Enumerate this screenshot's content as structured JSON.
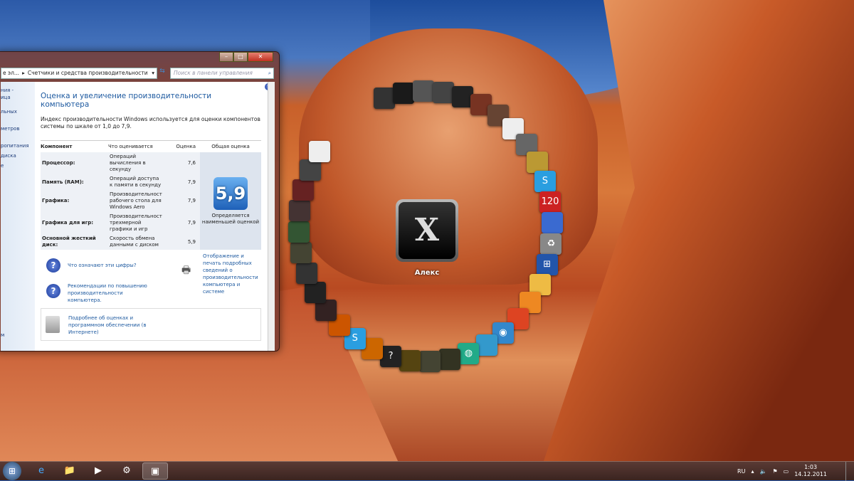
{
  "window": {
    "breadcrumb_prev": "е эл...",
    "breadcrumb_current": "Счетчики и средства производительности",
    "search_placeholder": "Поиск в панели управления",
    "sidebar_fragments": [
      "ния -",
      "ица",
      "льных",
      "метров",
      "ропитания",
      "диска",
      "е",
      "м"
    ],
    "title": "Оценка и увеличение производительности компьютера",
    "description": "Индекс производительности Windows используется для оценки компонентов системы по шкале от 1,0 до 7,9.",
    "table": {
      "headers": [
        "Компонент",
        "Что оценивается",
        "Оценка",
        "Общая оценка"
      ],
      "rows": [
        {
          "component": "Процессор:",
          "what": "Операций вычисления в секунду",
          "score": "7,6"
        },
        {
          "component": "Память (RAM):",
          "what": "Операций доступа к памяти в секунду",
          "score": "7,9"
        },
        {
          "component": "Графика:",
          "what": "Производительност рабочего стола для Windows Aero",
          "score": "7,9"
        },
        {
          "component": "Графика для игр:",
          "what": "Производительност трехмерной графики и игр",
          "score": "7,9"
        },
        {
          "component": "Основной жесткий диск:",
          "what": "Скорость обмена данными с диском",
          "score": "5,9"
        }
      ],
      "base_score": "5,9",
      "base_note": "Определяется наименьшей оценкой"
    },
    "links": {
      "what_numbers": "Что означают эти цифры?",
      "tips": "Рекомендации по повышению производительности компьютера.",
      "print": "Отображение и печать подробных сведений о производительности компьютера и системе",
      "more": "Подробнее об оценках и программном обеспечении (в Интернете)"
    }
  },
  "desktop": {
    "user_name": "Алекс",
    "user_tile_letter": "X",
    "icons": [
      "game",
      "game",
      "game",
      "game",
      "world-of-tanks",
      "game",
      "game",
      "solitaire",
      "chess",
      "game",
      "skype",
      "120x",
      "computer",
      "recycle-bin",
      "windows",
      "folder",
      "windows-flag",
      "office",
      "globe",
      "mail",
      "internet",
      "game",
      "game",
      "deus-ex",
      "help",
      "avast",
      "skype",
      "avast",
      "alex-mercer",
      "dead-rising-2",
      "call-of-duty",
      "game",
      "game",
      "game",
      "game",
      "rank",
      "payday"
    ]
  },
  "taskbar": {
    "items": [
      "start",
      "internet-explorer",
      "explorer",
      "media-player",
      "world-of-tanks",
      "performance"
    ],
    "lang": "RU",
    "time": "1:03",
    "date": "14.12.2011"
  }
}
